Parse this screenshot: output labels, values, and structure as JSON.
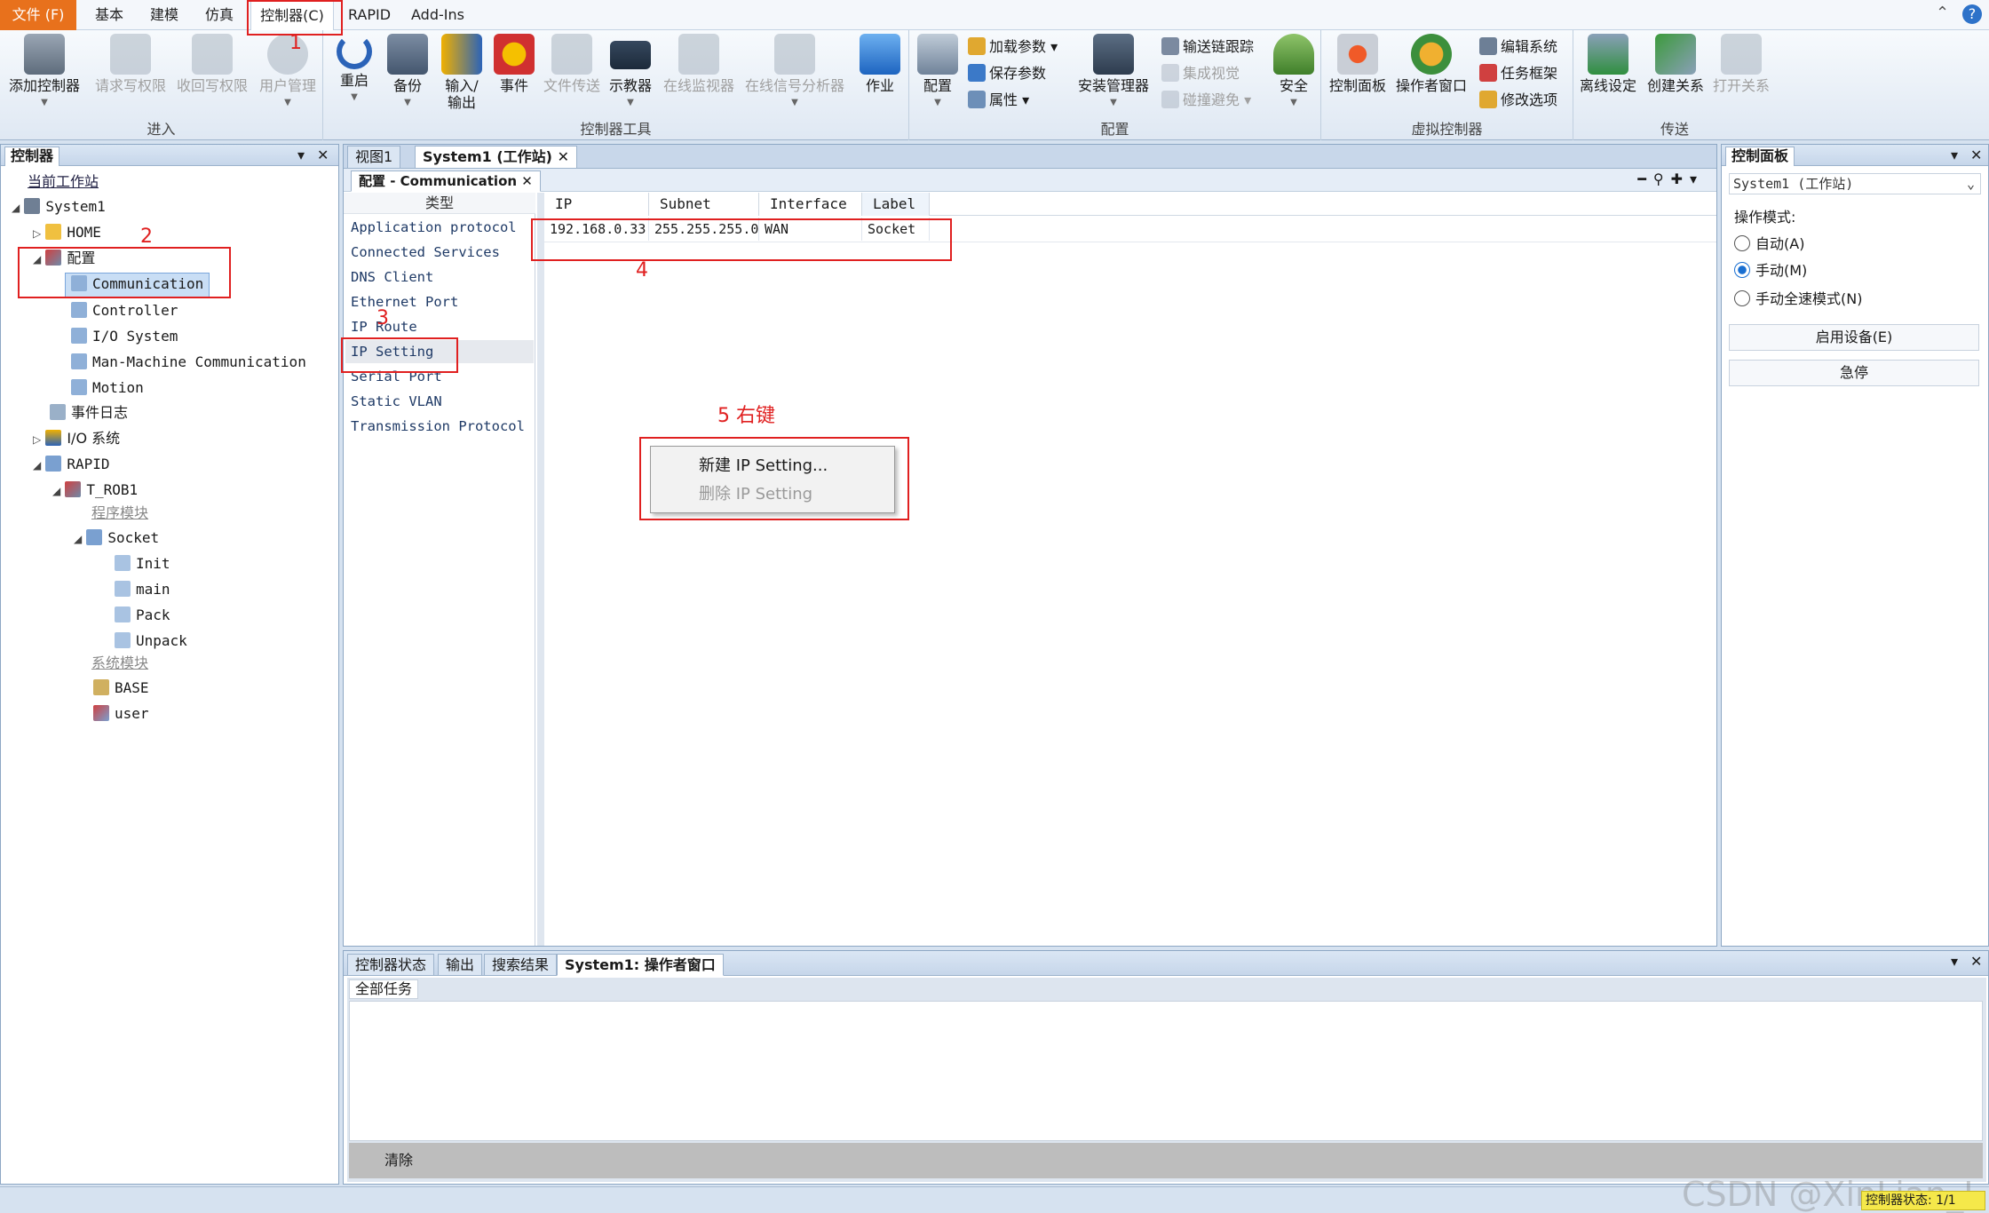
{
  "menubar": {
    "tabs": [
      "文件 (F)",
      "基本",
      "建模",
      "仿真",
      "控制器(C)",
      "RAPID",
      "Add-Ins"
    ],
    "help_icon": "question-icon",
    "min_icon": "collapse-ribbon-icon"
  },
  "ribbon": {
    "groups": {
      "enter": {
        "label": "进入",
        "buttons": [
          "添加控制器",
          "请求写权限",
          "收回写权限",
          "用户管理"
        ]
      },
      "tools": {
        "label": "控制器工具",
        "buttons": [
          "重启",
          "备份",
          "输入/\n输出",
          "事件",
          "文件传送",
          "示教器",
          "在线监视器",
          "在线信号分析器",
          "作业"
        ]
      },
      "config": {
        "label": "配置",
        "big": [
          "配置",
          "安装管理器",
          "安全"
        ],
        "small": [
          "加载参数",
          "保存参数",
          "属性",
          "输送链跟踪",
          "集成视觉",
          "碰撞避免"
        ]
      },
      "virtual": {
        "label": "虚拟控制器",
        "big": [
          "控制面板",
          "操作者窗口"
        ],
        "small": [
          "编辑系统",
          "任务框架",
          "修改选项"
        ]
      },
      "transfer": {
        "label": "传送",
        "buttons": [
          "离线设定",
          "创建关系",
          "打开关系"
        ]
      }
    }
  },
  "controller_panel": {
    "title": "控制器",
    "tree": {
      "current_station": "当前工作站",
      "system": "System1",
      "home": "HOME",
      "config": "配置",
      "config_items": [
        "Communication",
        "Controller",
        "I/O System",
        "Man-Machine Communication",
        "Motion"
      ],
      "event_log": "事件日志",
      "io_system": "I/O 系统",
      "rapid": "RAPID",
      "task": "T_ROB1",
      "program_modules": "程序模块",
      "socket": "Socket",
      "routines": [
        "Init",
        "main",
        "Pack",
        "Unpack"
      ],
      "system_modules": "系统模块",
      "sys_mods": [
        "BASE",
        "user"
      ]
    }
  },
  "doc_tabs": [
    "视图1",
    "System1 (工作站)"
  ],
  "config_tab": "配置 - Communication",
  "config": {
    "type_header": "类型",
    "types": [
      "Application protocol",
      "Connected Services",
      "DNS Client",
      "Ethernet Port",
      "IP Route",
      "IP Setting",
      "Serial Port",
      "Static VLAN",
      "Transmission Protocol"
    ],
    "columns": [
      "IP",
      "Subnet",
      "Interface",
      "Label"
    ],
    "rows": [
      {
        "ip": "192.168.0.33",
        "subnet": "255.255.255.0",
        "interface": "WAN",
        "label": "Socket"
      }
    ]
  },
  "context_menu": {
    "items": [
      "新建 IP Setting...",
      "删除 IP Setting"
    ]
  },
  "annotations": [
    "1",
    "2",
    "3",
    "4",
    "5 右键"
  ],
  "control_panel": {
    "title": "控制面板",
    "system_select": "System1 (工作站)",
    "mode_label": "操作模式:",
    "modes": [
      "自动(A)",
      "手动(M)",
      "手动全速模式(N)"
    ],
    "selected_mode": "手动(M)",
    "enable_button": "启用设备(E)",
    "estop_button": "急停"
  },
  "bottom": {
    "tabs": [
      "控制器状态",
      "输出",
      "搜索结果",
      "System1: 操作者窗口"
    ],
    "all_tasks": "全部任务",
    "clear_button": "清除"
  },
  "statusbar": {
    "text": "控制器状态: 1/1",
    "watermark": "CSDN @XinLian_L"
  },
  "colors": {
    "accent_file": "#e8711c",
    "annotation": "#e02020",
    "selection": "#c9def5"
  }
}
